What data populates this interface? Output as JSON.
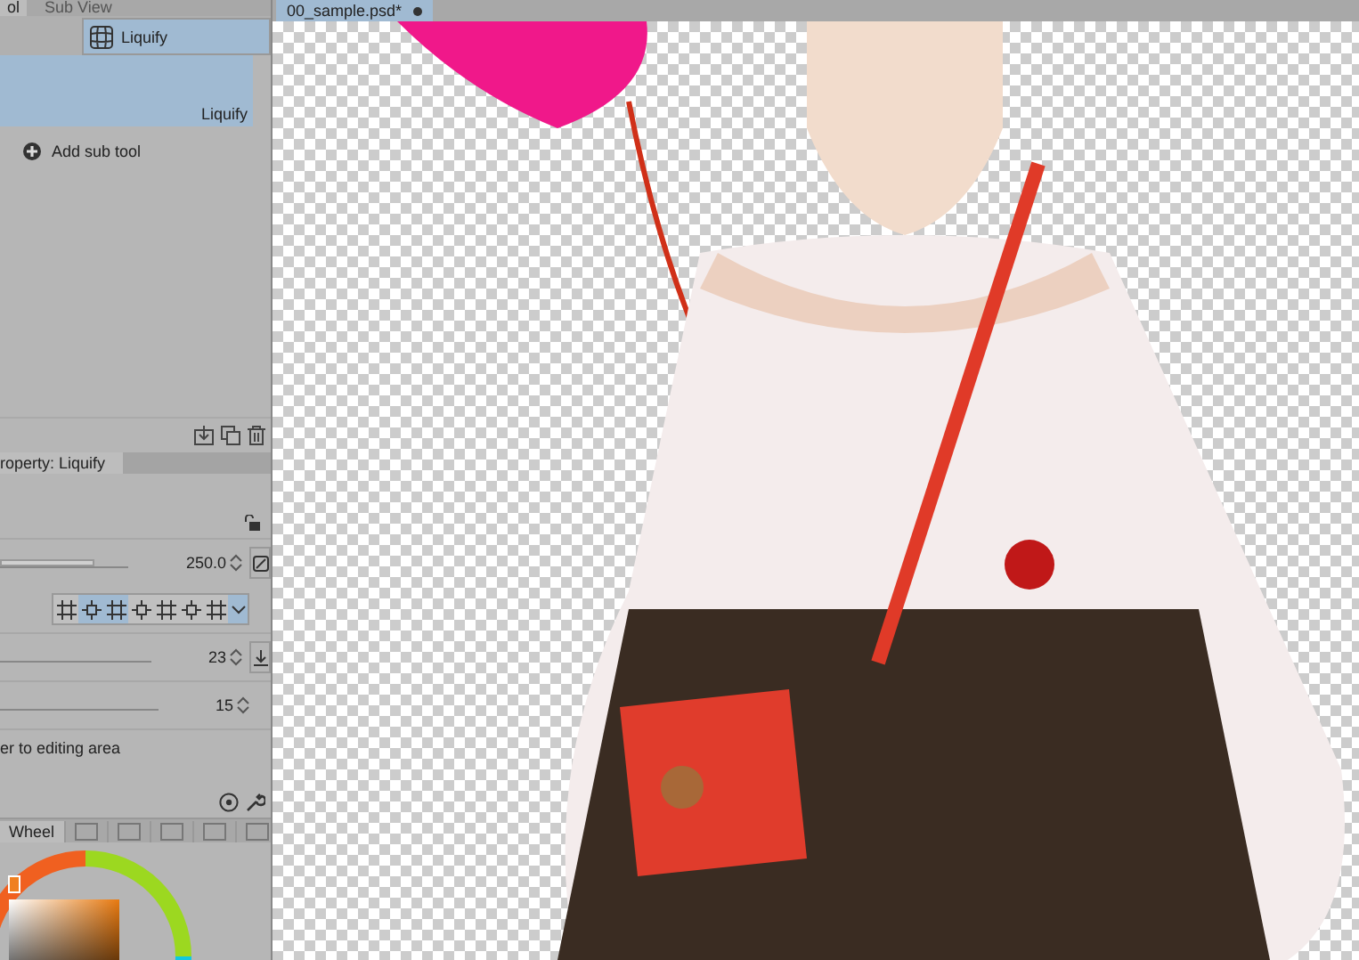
{
  "top_tabs": [
    {
      "label": "ol",
      "selected": true
    },
    {
      "label": "Sub View",
      "selected": false
    }
  ],
  "sub_tool_group": {
    "label": "Liquify",
    "selected": true
  },
  "sub_tools": [
    {
      "label": "Liquify",
      "selected": true
    }
  ],
  "add_sub_tool": "Add sub tool",
  "property_tab": "roperty: Liquify",
  "settings": [
    {
      "kind": "slider",
      "value": "250.0",
      "level": 0.73
    },
    {
      "kind": "modes",
      "modes": [
        {
          "selected": false
        },
        {
          "selected": true
        },
        {
          "selected": true
        },
        {
          "selected": false
        },
        {
          "selected": false
        },
        {
          "selected": false
        },
        {
          "selected": false
        }
      ]
    },
    {
      "kind": "slider",
      "value": "23"
    },
    {
      "kind": "slider",
      "value": "15"
    },
    {
      "kind": "text",
      "label": "er to editing area"
    }
  ],
  "color_tab": "Wheel",
  "document_tab": {
    "label": "00_sample.psd*",
    "selected": true
  }
}
